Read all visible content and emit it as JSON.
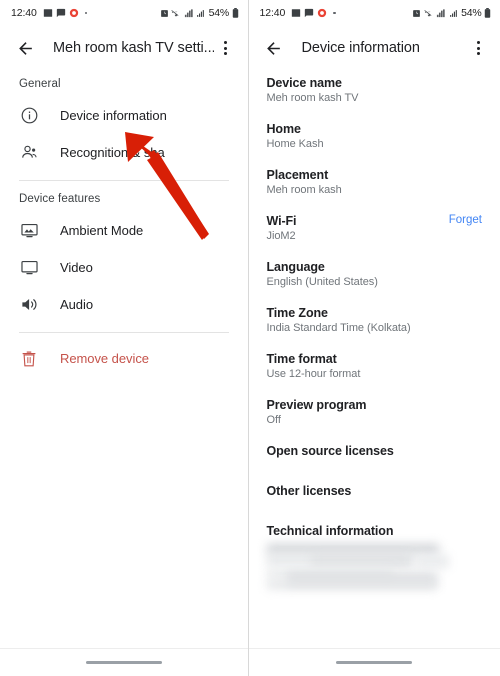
{
  "status_bar": {
    "clock": "12:40",
    "battery_percent": "54%",
    "left_icons": [
      "photos-icon",
      "message-icon",
      "record-icon",
      "dot-indicator"
    ],
    "right_icons": [
      "alarm-icon",
      "wifi-off-icon",
      "mobile-data-icon",
      "signal-bars-icon",
      "battery-icon"
    ]
  },
  "left_panel": {
    "appbar": {
      "back_icon": "back-arrow-icon",
      "title": "Meh room kash TV setti...",
      "overflow_icon": "overflow-menu-icon"
    },
    "sections": [
      {
        "header": "General",
        "items": [
          {
            "icon": "info-circle-icon",
            "label": "Device information",
            "danger": false
          },
          {
            "icon": "people-icon",
            "label": "Recognition & sha",
            "danger": false
          }
        ]
      },
      {
        "header": "Device features",
        "items": [
          {
            "icon": "ambient-mode-icon",
            "label": "Ambient Mode",
            "danger": false
          },
          {
            "icon": "video-icon",
            "label": "Video",
            "danger": false
          },
          {
            "icon": "audio-icon",
            "label": "Audio",
            "danger": false
          }
        ]
      },
      {
        "header": "",
        "items": [
          {
            "icon": "trash-icon",
            "label": "Remove device",
            "danger": true
          }
        ]
      }
    ]
  },
  "right_panel": {
    "appbar": {
      "back_icon": "back-arrow-icon",
      "title": "Device information",
      "overflow_icon": "overflow-menu-icon"
    },
    "items": [
      {
        "title": "Device name",
        "value": "Meh room kash TV",
        "action": ""
      },
      {
        "title": "Home",
        "value": "Home Kash",
        "action": ""
      },
      {
        "title": "Placement",
        "value": "Meh room kash",
        "action": ""
      },
      {
        "title": "Wi-Fi",
        "value": "JioM2",
        "action": "Forget"
      },
      {
        "title": "Language",
        "value": "English (United States)",
        "action": ""
      },
      {
        "title": "Time Zone",
        "value": "India Standard Time (Kolkata)",
        "action": ""
      },
      {
        "title": "Time format",
        "value": "Use 12-hour format",
        "action": ""
      },
      {
        "title": "Preview program",
        "value": "Off",
        "action": ""
      },
      {
        "title": "Open source licenses",
        "value": "",
        "action": ""
      },
      {
        "title": "Other licenses",
        "value": "",
        "action": ""
      },
      {
        "title": "Technical information",
        "value": "",
        "action": "",
        "redacted": true
      }
    ]
  },
  "annotations": {
    "arrow_color": "#d81f06",
    "left_arrow_target": "Device information",
    "right_arrow_target": "Wi-Fi"
  },
  "nav": {
    "pill": "gesture-nav-pill"
  },
  "colors": {
    "accent_link": "#4285f4",
    "danger": "#c5534b",
    "arrow": "#d81f06"
  }
}
